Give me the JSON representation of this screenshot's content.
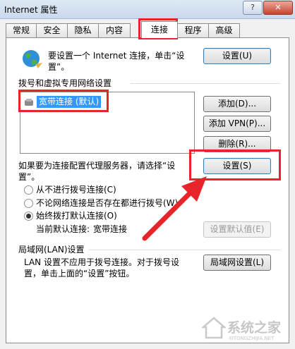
{
  "window": {
    "title": "Internet 属性",
    "help_label": "?",
    "close_label": "✕"
  },
  "tabs": [
    {
      "label": "常规"
    },
    {
      "label": "安全"
    },
    {
      "label": "隐私"
    },
    {
      "label": "内容"
    },
    {
      "label": "连接"
    },
    {
      "label": "程序"
    },
    {
      "label": "高级"
    }
  ],
  "setup": {
    "text_line1": "要设置一个 Internet 连接，单击“设",
    "text_line2": "置”。",
    "button": "设置(U)"
  },
  "dialup": {
    "section_title": "拨号和虚拟专用网络设置",
    "connections": [
      "宽带连接 (默认)"
    ],
    "add_button": "添加(D)...",
    "add_vpn_button": "添加 VPN(P)...",
    "delete_button": "删除(R)...",
    "proxy_text_line1": "如果要为连接配置代理服务器，请选择“设",
    "proxy_text_line2": "置”。",
    "settings_button": "设置(S)",
    "options": [
      {
        "label": "从不进行拨号连接(C)",
        "selected": false
      },
      {
        "label": "不论网络连接是否存在都进行拨号(W)",
        "selected": false
      },
      {
        "label": "始终拨打默认连接(O)",
        "selected": true
      }
    ],
    "current_default_label": "当前默认连接:",
    "current_default_value": "宽带连接",
    "set_default_button": "设置默认值(E)"
  },
  "lan": {
    "section_title": "局域网(LAN)设置",
    "text_line1": "LAN 设置不应用于拨号连接。对于拨号设",
    "text_line2": "置，单击上面的“设置”按钮。",
    "button": "局域网设置(L)"
  },
  "watermark": {
    "text": "系统之家",
    "subtext": "XITONGZHIJIA.NET"
  },
  "colors": {
    "highlight": "#e8242b",
    "selection": "#3399ff"
  }
}
